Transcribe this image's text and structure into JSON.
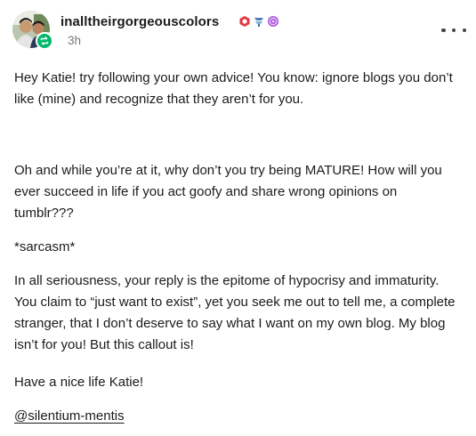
{
  "post": {
    "blog_name": "inalltheirgorgeouscolors",
    "timestamp": "3h",
    "avatar_icon": "avatar-photo",
    "reblog_icon": "reblog-icon",
    "more_icon": "more-options-icon",
    "badge_icons": [
      "sticker-badge-icon",
      "fish-badge-icon",
      "spiral-badge-icon"
    ],
    "paragraphs": [
      "Hey Katie! try following your own advice! You know: ignore blogs you don’t like (mine) and recognize that they aren’t for you.",
      "Oh and while you’re at it, why don’t you try being MATURE!  How will you ever succeed in life if you act goofy and share wrong opinions on tumblr???",
      "*sarcasm*",
      "In all seriousness, your reply is the epitome of hypocrisy and immaturity. You claim to “just want to exist”, yet you seek me out to tell me, a complete stranger, that I don’t deserve to say what I want on my own blog. My blog isn’t for you! But this callout is!",
      "Have a nice life Katie!"
    ],
    "mention": "@silentium-mentis"
  },
  "colors": {
    "text": "#1b1b1b",
    "muted": "#777777",
    "reblog_green": "#00b86b"
  }
}
